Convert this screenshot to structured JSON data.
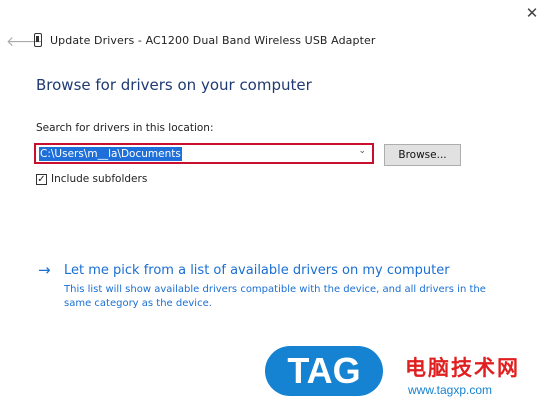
{
  "window": {
    "title": "Update Drivers - AC1200  Dual Band Wireless USB Adapter",
    "close_glyph": "✕",
    "back_glyph": "🡐"
  },
  "main": {
    "heading": "Browse for drivers on your computer",
    "search_label": "Search for drivers in this location:",
    "path_value": "C:\\Users\\m__la\\Documents",
    "combo_arrow": "⌄",
    "browse_label": "Browse...",
    "include_subfolders": {
      "checked": true,
      "mark": "✓",
      "label": "Include subfolders"
    },
    "pick_link": "Let me pick from a list of available drivers on my computer",
    "pick_arrow": "→",
    "pick_description": "This list will show available drivers compatible with the device, and all drivers in the same category as the device."
  },
  "watermark": {
    "logo_text": "TAG",
    "site_name": "电脑技术网",
    "url": "www.tagxp.com",
    "colors": {
      "logo_bg": "#1583d1",
      "site_name": "#e02020"
    }
  },
  "colors": {
    "heading": "#1f3a73",
    "link": "#1a6fd3",
    "highlight_border": "#c8102e",
    "selection": "#1e6fd9"
  }
}
